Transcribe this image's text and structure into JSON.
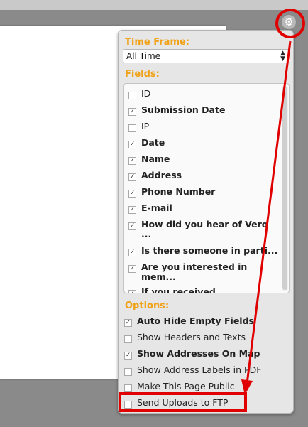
{
  "time_frame": {
    "label": "Time Frame:",
    "value": "All Time"
  },
  "fields": {
    "label": "Fields:",
    "items": [
      {
        "label": "ID",
        "checked": false,
        "bold": false
      },
      {
        "label": "Submission Date",
        "checked": true,
        "bold": true
      },
      {
        "label": "IP",
        "checked": false,
        "bold": false
      },
      {
        "label": "Date",
        "checked": true,
        "bold": true
      },
      {
        "label": "Name",
        "checked": true,
        "bold": true
      },
      {
        "label": "Address",
        "checked": true,
        "bold": true
      },
      {
        "label": "Phone Number",
        "checked": true,
        "bold": true
      },
      {
        "label": "E-mail",
        "checked": true,
        "bold": true
      },
      {
        "label": "How did you hear of Vero\n...",
        "checked": true,
        "bold": true
      },
      {
        "label": "Is there someone in parti...",
        "checked": true,
        "bold": true
      },
      {
        "label": "Are you interested in\nmem...",
        "checked": true,
        "bold": true
      },
      {
        "label": "If you received",
        "checked": true,
        "bold": true
      }
    ]
  },
  "options": {
    "label": "Options:",
    "items": [
      {
        "label": "Auto Hide Empty Fields",
        "checked": true,
        "bold": true
      },
      {
        "label": "Show Headers and Texts",
        "checked": false,
        "bold": false
      },
      {
        "label": "Show Addresses On Map",
        "checked": true,
        "bold": true
      },
      {
        "label": "Show Address Labels in PDF",
        "checked": false,
        "bold": false
      },
      {
        "label": "Make This Page Public",
        "checked": false,
        "bold": false
      },
      {
        "label": "Send Uploads to FTP",
        "checked": false,
        "bold": false
      }
    ]
  },
  "icons": {
    "settings": "gear-icon"
  },
  "colors": {
    "section_label": "#f0a218",
    "annotation": "#e00000"
  }
}
